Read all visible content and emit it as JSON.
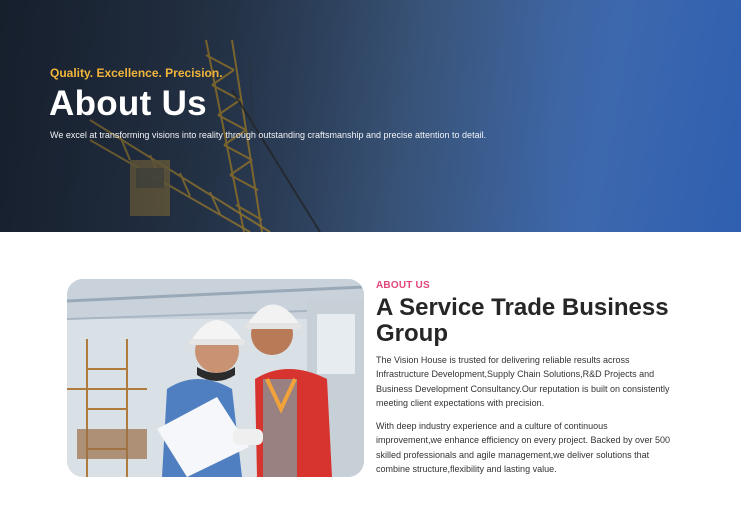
{
  "hero": {
    "tagline": "Quality. Excellence. Precision.",
    "title": "About Us",
    "subtitle": "We excel at transforming visions into reality through outstanding craftsmanship and precise attention to detail."
  },
  "about": {
    "eyebrow": "ABOUT US",
    "title": "A Service Trade Business Group",
    "paragraph1": "The Vision House is trusted for delivering reliable results across Infrastructure Development,Supply Chain Solutions,R&D Projects and Business Development Consultancy.Our reputation is built on consistently meeting client expectations with precision.",
    "paragraph2": "With deep industry experience and a culture of continuous improvement,we enhance efficiency on every project. Backed by over 500 skilled professionals and agile management,we deliver solutions that combine structure,flexibility and lasting value."
  },
  "colors": {
    "accent_gold": "#f2b53a",
    "accent_pink": "#e0457b",
    "hero_blue": "#3d68ae"
  },
  "images": {
    "hero_background": "construction-crane-photo",
    "about_photo": "engineers-reviewing-plans-photo"
  }
}
